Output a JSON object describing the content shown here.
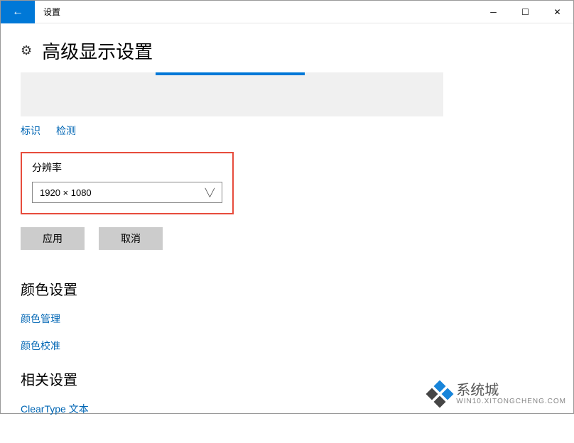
{
  "titlebar": {
    "title": "设置"
  },
  "page": {
    "title": "高级显示设置"
  },
  "links": {
    "identify": "标识",
    "detect": "检测"
  },
  "resolution": {
    "label": "分辨率",
    "value": "1920 × 1080"
  },
  "buttons": {
    "apply": "应用",
    "cancel": "取消"
  },
  "color_section": {
    "title": "颜色设置",
    "color_management": "颜色管理",
    "color_calibration": "颜色校准"
  },
  "related_section": {
    "title": "相关设置",
    "cleartype": "ClearType 文本"
  },
  "watermark": {
    "brand": "系统城",
    "sub": "WIN10.XITONGCHENG.COM"
  }
}
